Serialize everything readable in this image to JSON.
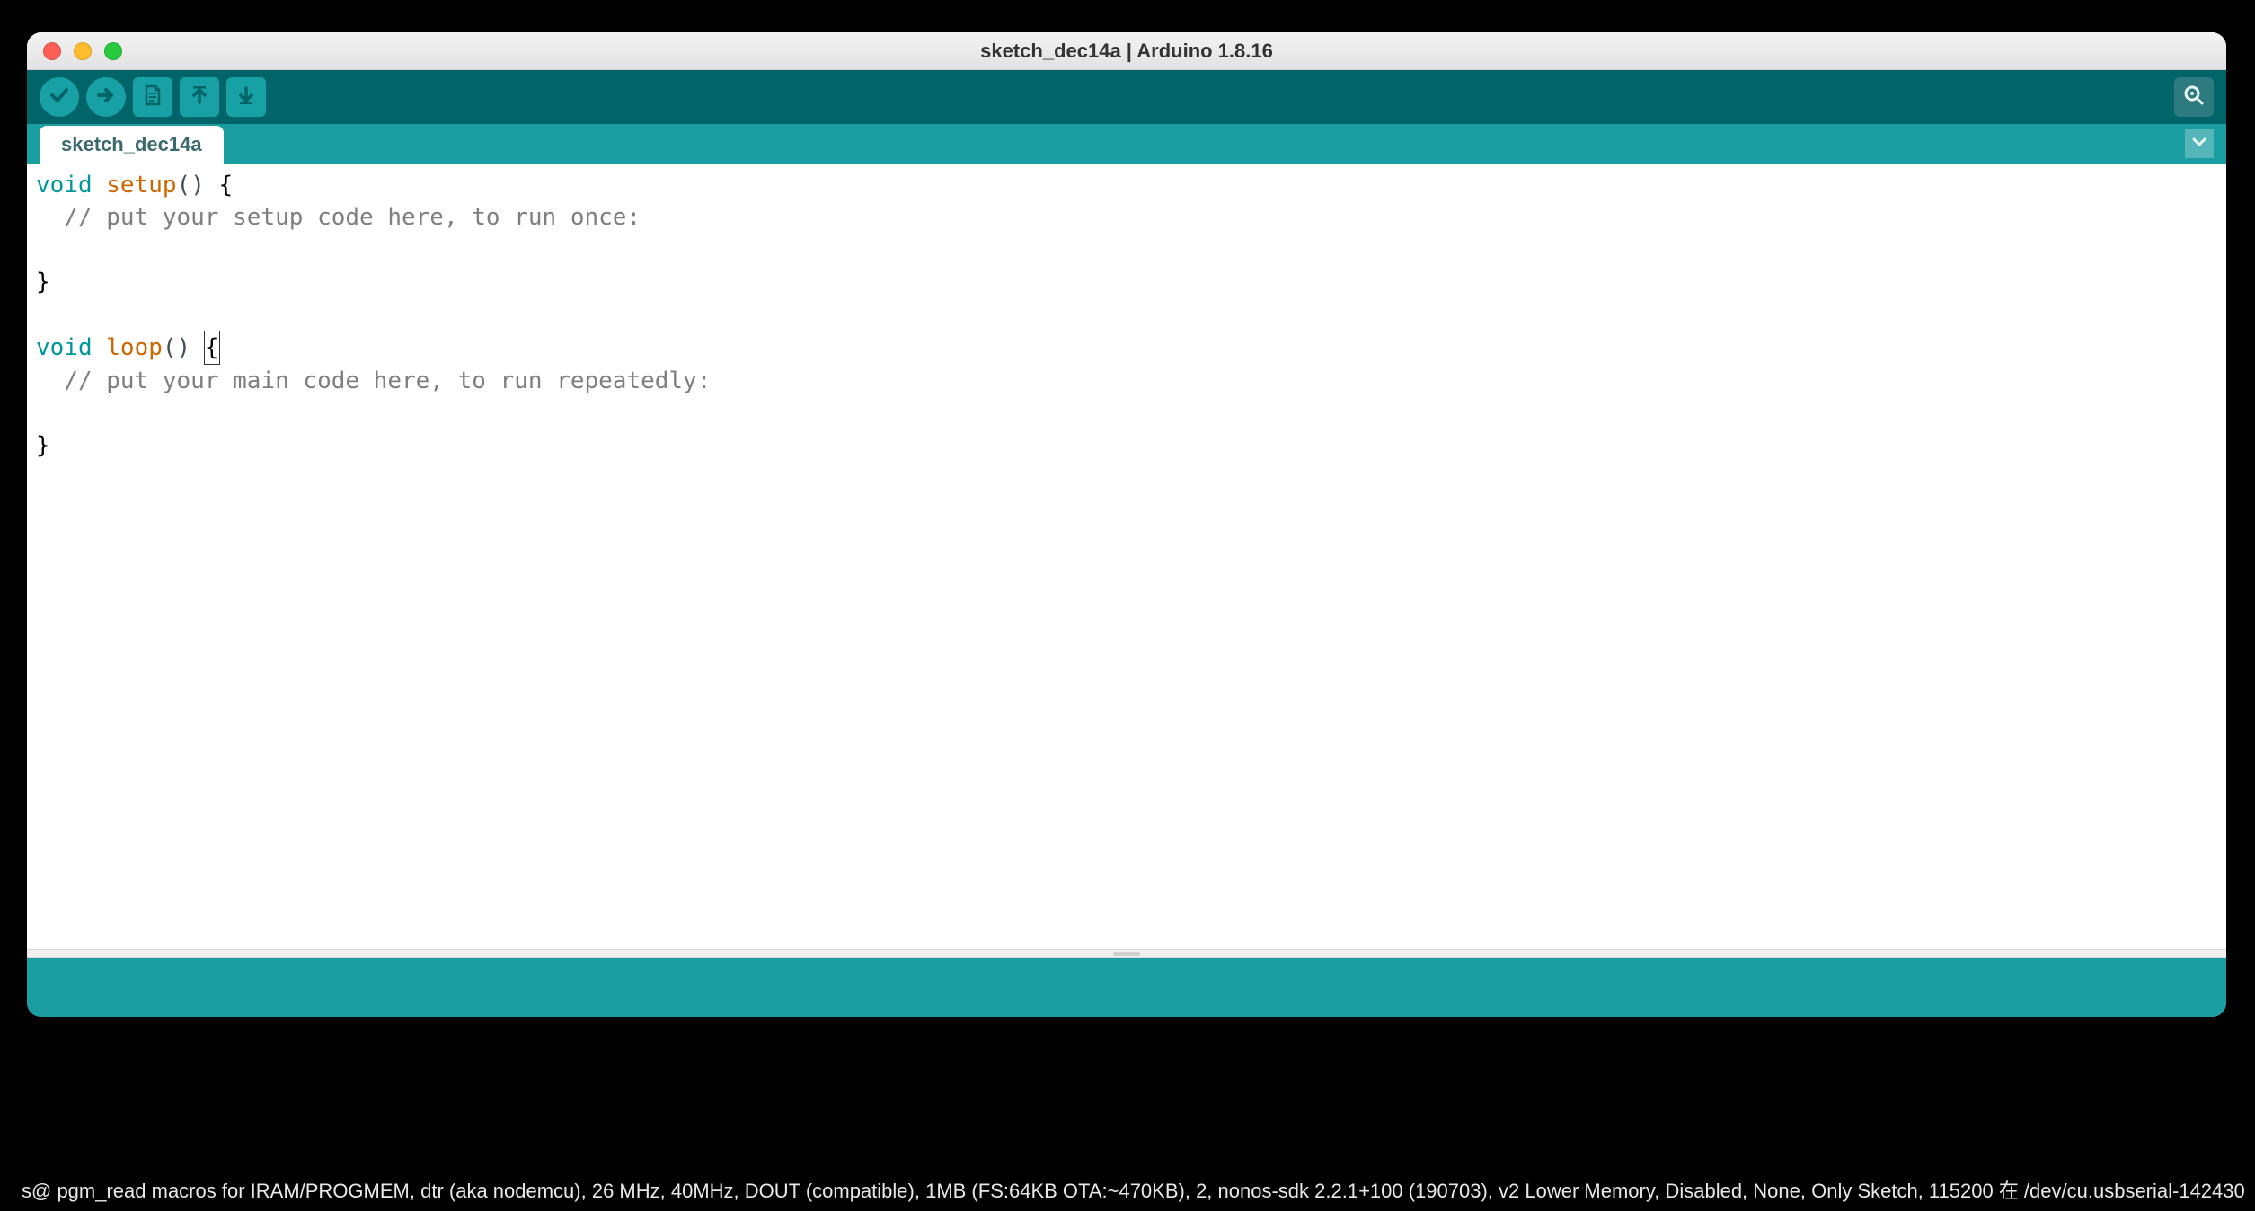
{
  "window": {
    "title": "sketch_dec14a | Arduino 1.8.16"
  },
  "toolbar": {
    "verify": "Verify",
    "upload": "Upload",
    "new": "New",
    "open": "Open",
    "save": "Save",
    "serial_monitor": "Serial Monitor"
  },
  "tabs": {
    "active": "sketch_dec14a"
  },
  "code": {
    "setup_kw": "void",
    "setup_name": "setup",
    "setup_parens": "()",
    "setup_brace_open": " {",
    "setup_comment": "  // put your setup code here, to run once:",
    "setup_brace_close": "}",
    "loop_kw": "void",
    "loop_name": "loop",
    "loop_parens": "()",
    "loop_brace_space": " ",
    "loop_brace_open": "{",
    "loop_comment": "  // put your main code here, to run repeatedly:",
    "loop_brace_close": "}"
  },
  "statusbar": {
    "text": "s@ pgm_read macros for IRAM/PROGMEM, dtr (aka nodemcu), 26 MHz, 40MHz, DOUT (compatible), 1MB (FS:64KB OTA:~470KB), 2, nonos-sdk 2.2.1+100 (190703), v2 Lower Memory, Disabled, None, Only Sketch, 115200 在 /dev/cu.usbserial-142430"
  }
}
